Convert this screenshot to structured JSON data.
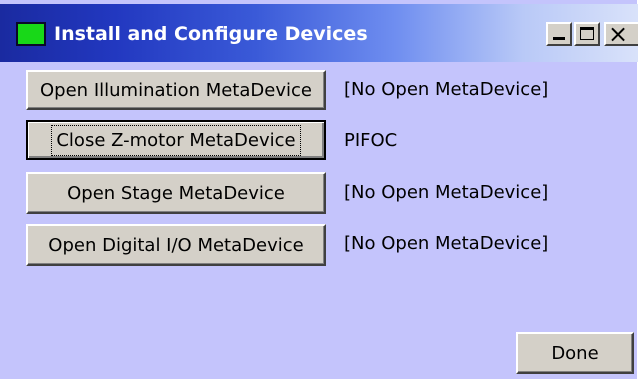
{
  "window": {
    "title": "Install and Configure Devices",
    "title_icon": "app-icon",
    "controls": {
      "minimize": "_",
      "maximize": "□",
      "close": "×"
    }
  },
  "devices": [
    {
      "button_label": "Open Illumination MetaDevice",
      "status": "[No Open MetaDevice]"
    },
    {
      "button_label": "Close Z-motor MetaDevice",
      "status": "PIFOC"
    },
    {
      "button_label": "Open Stage MetaDevice",
      "status": "[No Open MetaDevice]"
    },
    {
      "button_label": "Open Digital I/O MetaDevice",
      "status": "[No Open MetaDevice]"
    }
  ],
  "footer": {
    "done_label": "Done"
  },
  "colors": {
    "window_background": "#c4c4fc",
    "titlebar_start": "#1a2aa0",
    "titlebar_end": "#d9e2fa",
    "button_face": "#d4d0c8",
    "app_icon": "#18d818"
  }
}
